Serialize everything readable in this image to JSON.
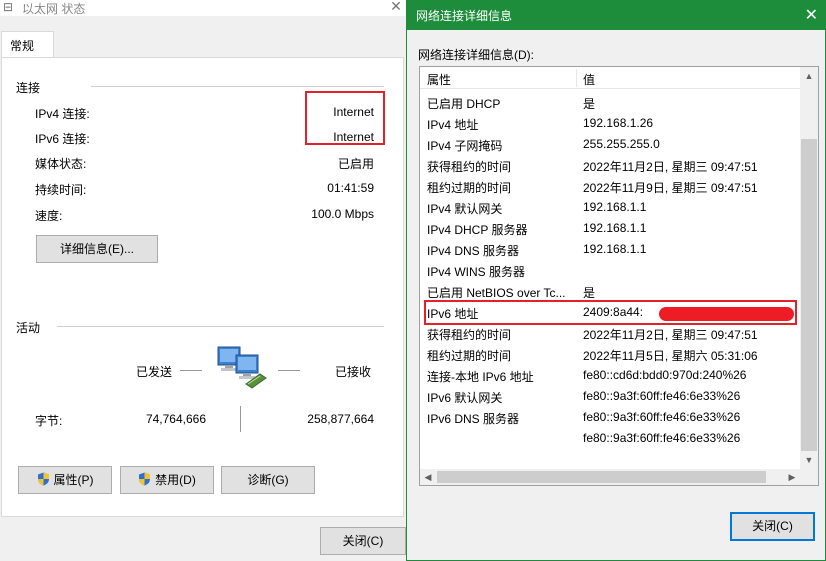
{
  "left_window": {
    "title": "以太网 状态",
    "tab_label": "常规",
    "connection": {
      "section_label": "连接",
      "rows": [
        {
          "label": "IPv4 连接:",
          "value": "Internet"
        },
        {
          "label": "IPv6 连接:",
          "value": "Internet"
        },
        {
          "label": "媒体状态:",
          "value": "已启用"
        },
        {
          "label": "持续时间:",
          "value": "01:41:59"
        },
        {
          "label": "速度:",
          "value": "100.0 Mbps"
        }
      ],
      "details_button": "详细信息(E)..."
    },
    "activity": {
      "section_label": "活动",
      "sent_label": "已发送",
      "received_label": "已接收",
      "bytes_label": "字节:",
      "bytes_sent": "74,764,666",
      "bytes_received": "258,877,664"
    },
    "buttons": {
      "properties": "属性(P)",
      "disable": "禁用(D)",
      "diagnose": "诊断(G)",
      "close": "关闭(C)"
    },
    "highlight_color": "#e0232b"
  },
  "right_dialog": {
    "title": "网络连接详细信息",
    "title_bar_color": "#1e8d3b",
    "details_label": "网络连接详细信息(D):",
    "columns": {
      "property": "属性",
      "value": "值"
    },
    "rows": [
      {
        "property": "已启用 DHCP",
        "value": "是"
      },
      {
        "property": "IPv4 地址",
        "value": "192.168.1.26"
      },
      {
        "property": "IPv4 子网掩码",
        "value": "255.255.255.0"
      },
      {
        "property": "获得租约的时间",
        "value": "2022年11月2日, 星期三 09:47:51"
      },
      {
        "property": "租约过期的时间",
        "value": "2022年11月9日, 星期三 09:47:51"
      },
      {
        "property": "IPv4 默认网关",
        "value": "192.168.1.1"
      },
      {
        "property": "IPv4 DHCP 服务器",
        "value": "192.168.1.1"
      },
      {
        "property": "IPv4 DNS 服务器",
        "value": "192.168.1.1"
      },
      {
        "property": "IPv4 WINS 服务器",
        "value": ""
      },
      {
        "property": "已启用 NetBIOS over Tc...",
        "value": "是"
      },
      {
        "property": "IPv6 地址",
        "value": "2409:8a44:"
      },
      {
        "property": "获得租约的时间",
        "value": "2022年11月2日, 星期三 09:47:51"
      },
      {
        "property": "租约过期的时间",
        "value": "2022年11月5日, 星期六 05:31:06"
      },
      {
        "property": "连接-本地 IPv6 地址",
        "value": "fe80::cd6d:bdd0:970d:240%26"
      },
      {
        "property": "IPv6 默认网关",
        "value": "fe80::9a3f:60ff:fe46:6e33%26"
      },
      {
        "property": "IPv6 DNS 服务器",
        "value": "fe80::9a3f:60ff:fe46:6e33%26"
      },
      {
        "property": "",
        "value": "fe80::9a3f:60ff:fe46:6e33%26"
      }
    ],
    "redaction_color": "#ee1c25",
    "close_button": "关闭(C)"
  }
}
